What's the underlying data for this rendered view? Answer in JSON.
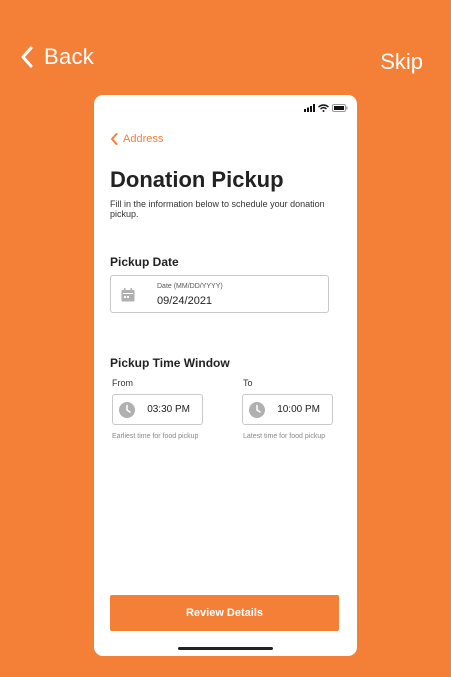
{
  "nav": {
    "back_label": "Back",
    "skip_label": "Skip"
  },
  "screen": {
    "back_link": "Address",
    "title": "Donation Pickup",
    "subtitle": "Fill in the information below to schedule your donation pickup.",
    "pickup_date": {
      "section_title": "Pickup Date",
      "field_label": "Date (MM/DD/YYYY)",
      "value": "09/24/2021"
    },
    "pickup_time": {
      "section_title": "Pickup Time Window",
      "from_label": "From",
      "from_value": "03:30 PM",
      "from_helper": "Earliest time for food pickup",
      "to_label": "To",
      "to_value": "10:00 PM",
      "to_helper": "Latest time for food pickup"
    },
    "review_button": "Review Details"
  },
  "colors": {
    "accent": "#F47F36",
    "background": "#F47F36",
    "card": "#FFFFFF"
  },
  "icons": [
    "chevron-left-icon",
    "signal-icon",
    "wifi-icon",
    "battery-icon",
    "calendar-icon",
    "clock-icon"
  ]
}
